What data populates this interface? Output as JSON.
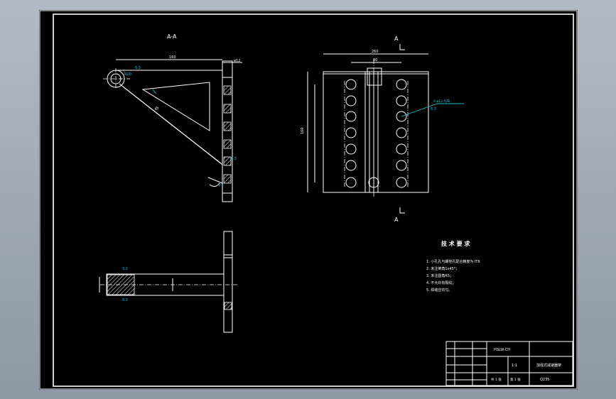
{
  "drawing": {
    "section_label": "A-A",
    "section_letter_top": "A",
    "section_letter_bottom": "A",
    "tech_requirements": {
      "title": "技 术 要 求",
      "items": [
        "1. 小孔孔与螺栓孔配合精度为 IT6",
        "2. 未注倒角1x45°；",
        "3. 未注圆角R5；",
        "4. 不允许有裂纹；",
        "5. 焊缝应均匀。"
      ]
    },
    "title_block": {
      "part_label": "HSLW-CH",
      "scale": "1:1",
      "name": "加强式减速器架",
      "material": "Q235",
      "sheet": "共 1 张",
      "page": "第 1 张"
    },
    "dimensions": {
      "top_width": "260",
      "inner_width": "80",
      "side_height": "160",
      "leader_callout": "6-ø12 均布"
    }
  },
  "colors": {
    "background": "#000000",
    "line": "#ffffff",
    "annotation": "#17c5d2",
    "chrome": "#a3aab6"
  }
}
